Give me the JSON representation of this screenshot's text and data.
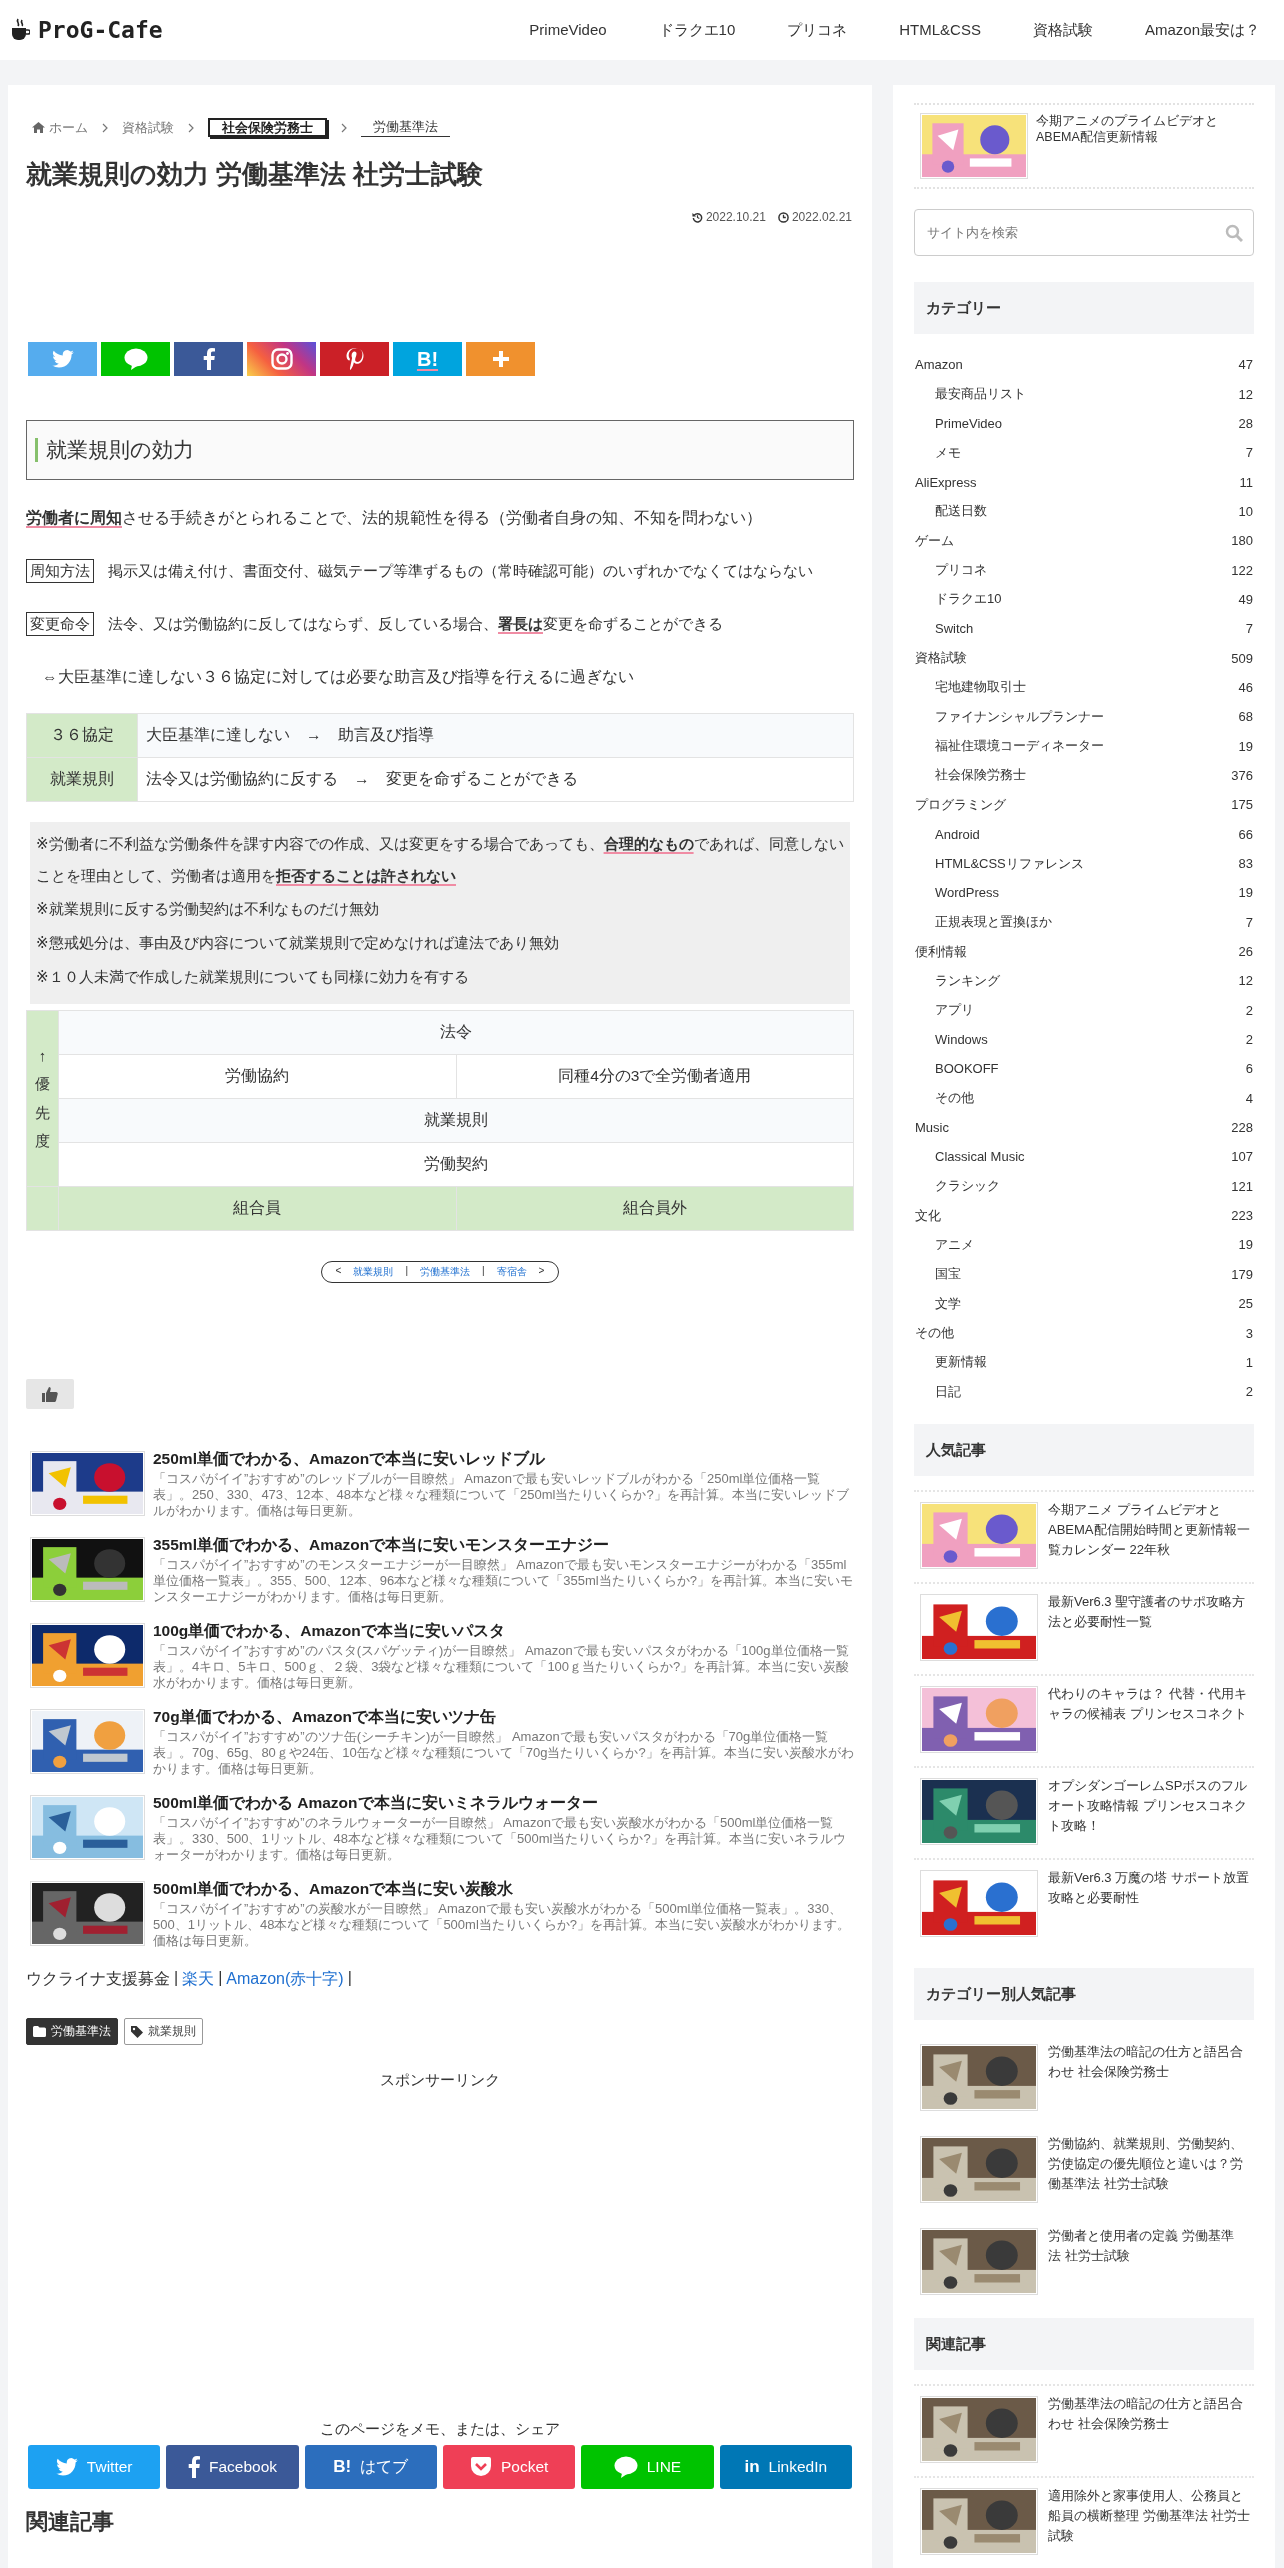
{
  "header": {
    "logo": "ProG-Cafe",
    "nav": [
      "PrimeVideo",
      "ドラクエ10",
      "プリコネ",
      "HTML&CSS",
      "資格試験",
      "Amazon最安は？"
    ]
  },
  "breadcrumb": [
    {
      "kind": "home",
      "label": "ホーム"
    },
    {
      "kind": "link",
      "label": "資格試験"
    },
    {
      "kind": "boxed",
      "label": "社会保険労務士"
    },
    {
      "kind": "underlined",
      "label": "労働基準法"
    }
  ],
  "article": {
    "title": "就業規則の効力 労働基準法 社労士試験",
    "updated": "2022.10.21",
    "published": "2022.02.21",
    "share_icons": [
      {
        "kind": "twitter"
      },
      {
        "kind": "line"
      },
      {
        "kind": "facebook"
      },
      {
        "kind": "instagram"
      },
      {
        "kind": "pinterest"
      },
      {
        "kind": "hatena",
        "icon_text": "B!"
      },
      {
        "kind": "more"
      }
    ],
    "heading": "就業規則の効力",
    "paragraphs": [
      {
        "kind": "text",
        "text": "**労働者に周知**させる手続きがとられることで、法的規範性を得る（労働者自身の知、不知を問わない）"
      },
      {
        "kind": "labeled",
        "label": "周知方法",
        "text": "掲示又は備え付け、書面交付、磁気テープ等準ずるもの（常時確認可能）のいずれかでなくてはならない"
      },
      {
        "kind": "labeled",
        "label": "変更命令",
        "text": "法令、又は労働協約に反してはならず、反している場合、**署長は**変更を命ずることができる"
      },
      {
        "kind": "indent",
        "text": "⇔大臣基準に達しない３６協定に対しては必要な助言及び指導を行えるに過ぎない"
      }
    ],
    "table": [
      {
        "head": "３６協定",
        "cell": "大臣基準に達しない　→　助言及び指導"
      },
      {
        "head": "就業規則",
        "cell": "法令又は労働協約に反する　→　変更を命ずることができる"
      }
    ],
    "notes": [
      "※労働者に不利益な労働条件を課す内容での作成、又は変更をする場合であっても、**合理的なもの**であれば、同意しないことを理由として、労働者は適用を**拒否することは許されない**",
      "※就業規則に反する労働契約は不利なものだけ無効",
      "※懲戒処分は、事由及び内容について就業規則で定めなければ違法であり無効",
      "※１０人未満で作成した就業規則についても同様に効力を有する"
    ],
    "priority_table": {
      "side_label": "↑優先度",
      "rows": [
        [
          {
            "text": "法令",
            "colspan": 2
          }
        ],
        [
          {
            "text": "労働協約"
          },
          {
            "text": "同種4分の3で全労働者適用"
          }
        ],
        [
          {
            "text": "就業規則",
            "colspan": 2
          }
        ],
        [
          {
            "text": "労働契約",
            "colspan": 2
          }
        ]
      ],
      "footer": [
        "組合員",
        "組合員外"
      ]
    },
    "series_nav": [
      {
        "kind": "arrow",
        "text": "<"
      },
      {
        "kind": "link",
        "text": "就業規則"
      },
      {
        "kind": "sep",
        "text": "|"
      },
      {
        "kind": "link",
        "text": "労働基準法"
      },
      {
        "kind": "sep",
        "text": "|"
      },
      {
        "kind": "link",
        "text": "寄宿舎"
      },
      {
        "kind": "arrow",
        "text": ">"
      }
    ],
    "cards": [
      {
        "title": "250ml単価でわかる、Amazonで本当に安いレッドブル",
        "excerpt": "「コスパがイイ”おすすめ”のレッドブルが一目瞭然」 Amazonで最も安いレッドブルがわかる「250ml単位価格一覧表」。250、330、473、12本、48本など様々な種類について「250ml当たりいくらか?」を再計算。本当に安いレッドブルがわかります。価格は毎日更新。"
      },
      {
        "title": "355ml単価でわかる、Amazonで本当に安いモンスターエナジー",
        "excerpt": "「コスパがイイ”おすすめ”のモンスターエナジーが一目瞭然」 Amazonで最も安いモンスターエナジーがわかる「355ml単位価格一覧表」。355、500、12本、96本など様々な種類について「355ml当たりいくらか?」を再計算。本当に安いモンスターエナジーがわかります。価格は毎日更新。"
      },
      {
        "title": "100g単価でわかる、Amazonで本当に安いパスタ",
        "excerpt": "「コスパがイイ”おすすめ”のパスタ(スパゲッティ)が一目瞭然」 Amazonで最も安いパスタがわかる「100g単位価格一覧表」。4キロ、5キロ、500ｇ、２袋、3袋など様々な種類について「100ｇ当たりいくらか?」を再計算。本当に安い炭酸水がわかります。価格は毎日更新。"
      },
      {
        "title": "70g単価でわかる、Amazonで本当に安いツナ缶",
        "excerpt": "「コスパがイイ”おすすめ”のツナ缶(シーチキン)が一目瞭然」 Amazonで最も安いパスタがわかる「70g単位価格一覧表」。70g、65g、80ｇや24缶、10缶など様々な種類について「70g当たりいくらか?」を再計算。本当に安い炭酸水がわかります。価格は毎日更新。"
      },
      {
        "title": "500ml単価でわかる Amazonで本当に安いミネラルウォーター",
        "excerpt": "「コスパがイイ”おすすめ”のネラルウォーターが一目瞭然」 Amazonで最も安い炭酸水がわかる「500ml単位価格一覧表」。330、500、1リットル、48本など様々な種類について「500ml当たりいくらか?」を再計算。本当に安いネラルウォーターがわかります。価格は毎日更新。"
      },
      {
        "title": "500ml単価でわかる、Amazonで本当に安い炭酸水",
        "excerpt": "「コスパがイイ”おすすめ”の炭酸水が一目瞭然」 Amazonで最も安い炭酸水がわかる「500ml単位価格一覧表」。330、500、1リットル、48本など様々な種類について「500ml当たりいくらか?」を再計算。本当に安い炭酸水がわかります。価格は毎日更新。"
      }
    ],
    "donation": [
      {
        "kind": "text",
        "text": "ウクライナ支援募金"
      },
      {
        "kind": "sep",
        "text": "|"
      },
      {
        "kind": "link",
        "text": "楽天"
      },
      {
        "kind": "sep",
        "text": "|"
      },
      {
        "kind": "link",
        "text": "Amazon(赤十字)"
      },
      {
        "kind": "sep",
        "text": "|"
      }
    ],
    "tags": [
      {
        "kind": "category",
        "label": "労働基準法"
      },
      {
        "kind": "tag",
        "label": "就業規則"
      }
    ],
    "sponsor": "スポンサーリンク",
    "share_heading": "このページをメモ、または、シェア",
    "share_buttons": [
      {
        "kind": "twitter",
        "label": "Twitter"
      },
      {
        "kind": "facebook",
        "label": "Facebook"
      },
      {
        "kind": "hatena",
        "label": "はてブ",
        "icon_text": "B!"
      },
      {
        "kind": "pocket",
        "label": "Pocket"
      },
      {
        "kind": "line",
        "label": "LINE"
      },
      {
        "kind": "linkedin",
        "label": "LinkedIn",
        "icon_text": "in"
      }
    ],
    "related_heading": "関連記事"
  },
  "sidebar": {
    "top_post": "今期アニメのプライムビデオとABEMA配信更新情報",
    "search": {
      "placeholder": "サイト内を検索"
    },
    "categories_heading": "カテゴリー",
    "categories": [
      {
        "name": "Amazon",
        "count": "47",
        "children": [
          {
            "name": "最安商品リスト",
            "count": "12"
          },
          {
            "name": "PrimeVideo",
            "count": "28"
          },
          {
            "name": "メモ",
            "count": "7"
          }
        ]
      },
      {
        "name": "AliExpress",
        "count": "11",
        "children": [
          {
            "name": "配送日数",
            "count": "10"
          }
        ]
      },
      {
        "name": "ゲーム",
        "count": "180",
        "children": [
          {
            "name": "プリコネ",
            "count": "122"
          },
          {
            "name": "ドラクエ10",
            "count": "49"
          },
          {
            "name": "Switch",
            "count": "7"
          }
        ]
      },
      {
        "name": "資格試験",
        "count": "509",
        "children": [
          {
            "name": "宅地建物取引士",
            "count": "46"
          },
          {
            "name": "ファイナンシャルプランナー",
            "count": "68"
          },
          {
            "name": "福祉住環境コーディネーター",
            "count": "19"
          },
          {
            "name": "社会保険労務士",
            "count": "376"
          }
        ]
      },
      {
        "name": "プログラミング",
        "count": "175",
        "children": [
          {
            "name": "Android",
            "count": "66"
          },
          {
            "name": "HTML&CSSリファレンス",
            "count": "83"
          },
          {
            "name": "WordPress",
            "count": "19"
          },
          {
            "name": "正規表現と置換ほか",
            "count": "7"
          }
        ]
      },
      {
        "name": "便利情報",
        "count": "26",
        "children": [
          {
            "name": "ランキング",
            "count": "12"
          },
          {
            "name": "アプリ",
            "count": "2"
          },
          {
            "name": "Windows",
            "count": "2"
          },
          {
            "name": "BOOKOFF",
            "count": "6"
          },
          {
            "name": "その他",
            "count": "4"
          }
        ]
      },
      {
        "name": "Music",
        "count": "228",
        "children": [
          {
            "name": "Classical Music",
            "count": "107"
          },
          {
            "name": "クラシック",
            "count": "121"
          }
        ]
      },
      {
        "name": "文化",
        "count": "223",
        "children": [
          {
            "name": "アニメ",
            "count": "19"
          },
          {
            "name": "国宝",
            "count": "179"
          },
          {
            "name": "文学",
            "count": "25"
          }
        ]
      },
      {
        "name": "その他",
        "count": "3",
        "children": [
          {
            "name": "更新情報",
            "count": "1"
          },
          {
            "name": "日記",
            "count": "2"
          }
        ]
      }
    ],
    "popular_heading": "人気記事",
    "popular": [
      "今期アニメ プライムビデオとABEMA配信開始時間と更新情報一覧カレンダー 22年秋",
      "最新Ver6.3 聖守護者のサポ攻略方法と必要耐性一覧",
      "代わりのキャラは？ 代替・代用キャラの候補表 プリンセスコネクト",
      "オプシダンゴーレムSPボスのフルオート攻略情報 プリンセスコネクト攻略！",
      "最新Ver6.3 万魔の塔 サポート放置攻略と必要耐性"
    ],
    "category_popular_heading": "カテゴリー別人気記事",
    "category_popular": [
      "労働基準法の暗記の仕方と語呂合わせ 社会保険労務士",
      "労働協約、就業規則、労働契約、労使協定の優先順位と違いは？労働基準法 社労士試験",
      "労働者と使用者の定義 労働基準法 社労士試験"
    ],
    "related_heading": "関連記事",
    "related": [
      "労働基準法の暗記の仕方と語呂合わせ 社会保険労務士",
      "適用除外と家事使用人、公務員と船員の横断整理 労働基準法 社労士試験"
    ]
  }
}
